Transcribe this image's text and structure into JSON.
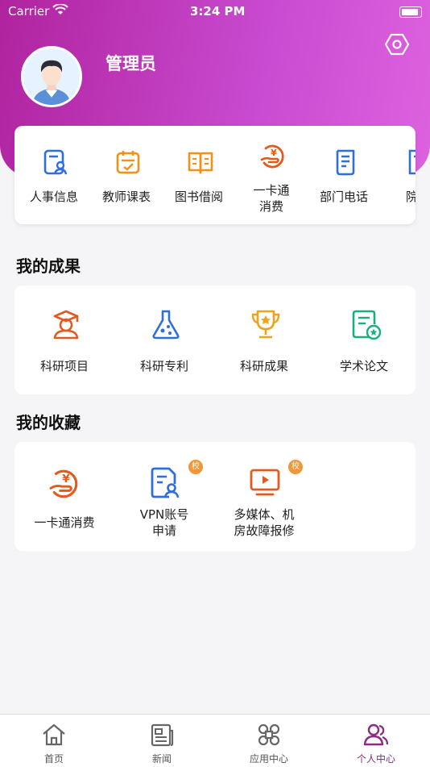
{
  "status_bar": {
    "carrier": "Carrier",
    "time": "3:24 PM"
  },
  "profile": {
    "name": "管理员"
  },
  "quick_actions": [
    {
      "label": "人事信息",
      "icon": "personnel-icon"
    },
    {
      "label": "教师课表",
      "icon": "calendar-icon"
    },
    {
      "label": "图书借阅",
      "icon": "book-icon"
    },
    {
      "label": "一卡通消费",
      "label_lines": [
        "一卡通",
        "消费"
      ],
      "icon": "card-payment-icon"
    },
    {
      "label": "部门电话",
      "icon": "phonebook-icon"
    },
    {
      "label": "院系",
      "icon": "department-icon"
    }
  ],
  "achievements": {
    "title": "我的成果",
    "items": [
      {
        "label": "科研项目",
        "icon": "graduate-icon"
      },
      {
        "label": "科研专利",
        "icon": "flask-icon"
      },
      {
        "label": "科研成果",
        "icon": "trophy-icon"
      },
      {
        "label": "学术论文",
        "icon": "paper-icon"
      }
    ]
  },
  "favorites": {
    "title": "我的收藏",
    "items": [
      {
        "label": "一卡通消费",
        "icon": "card-payment-icon",
        "badge": ""
      },
      {
        "label_lines": [
          "VPN账号",
          "申请"
        ],
        "icon": "vpn-doc-icon",
        "badge": "校"
      },
      {
        "label_lines": [
          "多媒体、机",
          "房故障报修"
        ],
        "icon": "media-repair-icon",
        "badge": "校"
      }
    ]
  },
  "tabs": [
    {
      "label": "首页",
      "icon": "home-icon",
      "active": false
    },
    {
      "label": "新闻",
      "icon": "news-icon",
      "active": false
    },
    {
      "label": "应用中心",
      "icon": "apps-icon",
      "active": false
    },
    {
      "label": "个人中心",
      "icon": "profile-icon",
      "active": true
    }
  ],
  "colors": {
    "header": "#c23cc0",
    "active_tab": "#8b2b84",
    "blue": "#2f6fdb",
    "orange": "#f0911a",
    "red": "#e35a1e",
    "green": "#17b07a"
  }
}
